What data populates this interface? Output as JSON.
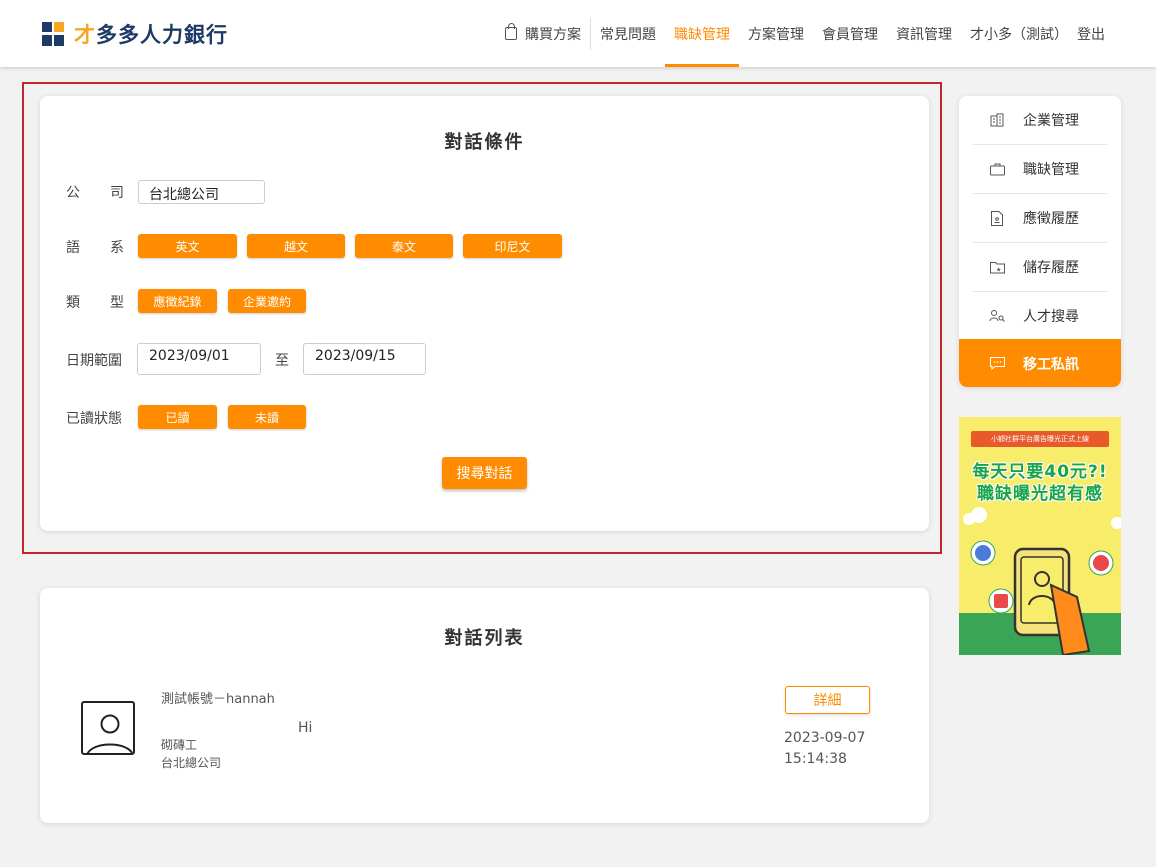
{
  "header": {
    "logo_accent": "才",
    "logo_rest": "多多人力銀行",
    "nav": {
      "buy": "購買方案",
      "faq": "常見問題",
      "jobs": "職缺管理",
      "plans": "方案管理",
      "members": "會員管理",
      "info": "資訊管理",
      "user": "才小多（測試）",
      "logout": "登出"
    }
  },
  "filter": {
    "title": "對話條件",
    "company_label_a": "公",
    "company_label_b": "司",
    "company_value": "台北總公司",
    "language_label_a": "語",
    "language_label_b": "系",
    "languages": [
      "英文",
      "越文",
      "泰文",
      "印尼文"
    ],
    "type_label_a": "類",
    "type_label_b": "型",
    "types": [
      "應徵紀錄",
      "企業邀約"
    ],
    "date_label": "日期範圍",
    "date_from": "2023/09/01",
    "date_sep": "至",
    "date_to": "2023/09/15",
    "read_label": "已讀狀態",
    "read_states": [
      "已讀",
      "未讀"
    ],
    "search_button": "搜尋對話"
  },
  "list": {
    "title": "對話列表",
    "items": [
      {
        "name": "測試帳號－hannah",
        "message": "Hi",
        "position": "砌磚工",
        "company": "台北總公司",
        "detail_button": "詳細",
        "date": "2023-09-07",
        "time": "15:14:38"
      }
    ]
  },
  "sidebar": {
    "items": [
      {
        "label": "企業管理",
        "icon": "building-icon"
      },
      {
        "label": "職缺管理",
        "icon": "briefcase-icon"
      },
      {
        "label": "應徵履歷",
        "icon": "document-icon"
      },
      {
        "label": "儲存履歷",
        "icon": "folder-star-icon"
      },
      {
        "label": "人才搜尋",
        "icon": "person-search-icon"
      },
      {
        "label": "移工私訊",
        "icon": "chat-icon",
        "active": true
      }
    ]
  },
  "ad": {
    "ribbon": "小額社群平台廣告曝光正式上線",
    "line1": "每天只要40元?!",
    "line2": "職缺曝光超有感"
  },
  "colors": {
    "accent": "#ff8c00",
    "brand": "#1e3a66",
    "highlight_outline": "#c0262c"
  }
}
